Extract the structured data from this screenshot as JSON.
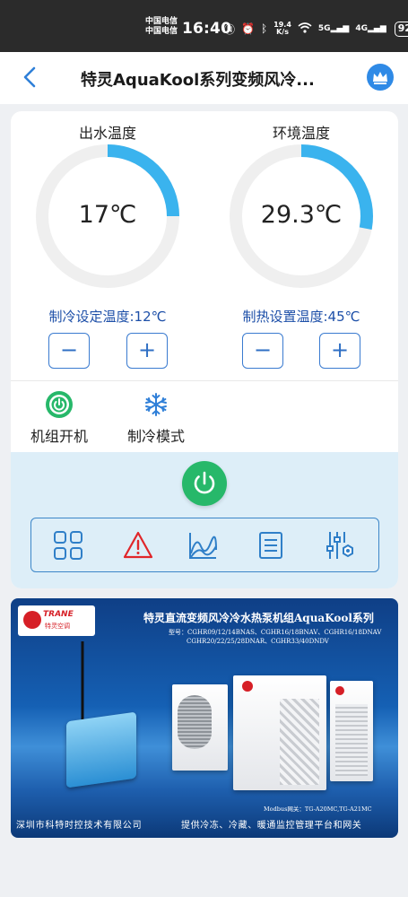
{
  "status_bar": {
    "carrier_1": "中国电信",
    "carrier_2": "中国电信",
    "time": "16:40",
    "speed_value": "19.4",
    "speed_unit": "K/s",
    "network_1": "5G",
    "network_2": "4G",
    "battery": "92"
  },
  "header": {
    "title": "特灵AquaKool系列变频风冷..."
  },
  "gauges": [
    {
      "title": "出水温度",
      "value": "17℃",
      "level": 0.25
    },
    {
      "title": "环境温度",
      "value": "29.3℃",
      "level": 0.28
    }
  ],
  "setpoints": {
    "cooling_label": "制冷设定温度:12℃",
    "heating_label": "制热设置温度:45℃",
    "minus": "−",
    "plus": "+"
  },
  "modes": {
    "unit_power_label": "机组开机",
    "cooling_mode_label": "制冷模式"
  },
  "colors": {
    "accent_blue": "#3ab3ee",
    "power_green": "#27b86a",
    "alarm_red": "#e0262a",
    "setpoint_text": "#1d4fa8"
  },
  "toolbar_icons": [
    "grid-icon",
    "alarm-icon",
    "curve-chart-icon",
    "list-icon",
    "settings-sliders-icon"
  ],
  "banner": {
    "logo_text": "TRANE",
    "logo_cn": "特灵空调",
    "headline": "特灵直流变频风冷冷水热泵机组AquaKool系列",
    "models_line1": "型号：CGHR09/12/14BNAS、CGHR16/18BNAV、CGHR16/18DNAV",
    "models_line2": "CGHR20/22/25/28DNAR、CGHR33/40DNDV",
    "gateway_label": "Modbus网关：TG-A20MC,TG-A21MC",
    "company": "深圳市科特时控技术有限公司",
    "slogan": "提供冷冻、冷藏、暖通监控管理平台和网关"
  }
}
